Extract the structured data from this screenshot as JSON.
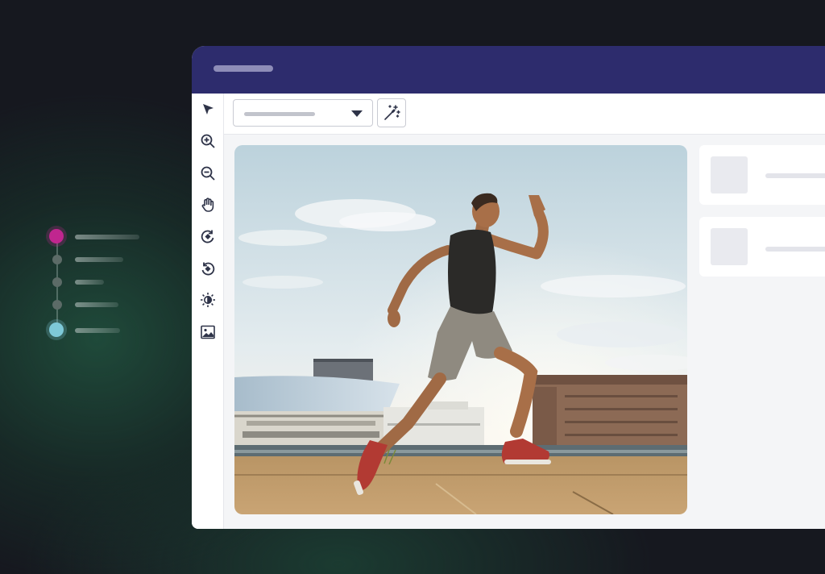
{
  "steps": [
    {
      "state": "active",
      "color": "#c0268f"
    },
    {
      "state": "pending"
    },
    {
      "state": "pending"
    },
    {
      "state": "pending"
    },
    {
      "state": "done",
      "color": "#7ec9d8"
    }
  ],
  "window": {
    "titlebar_color": "#2d2c6d",
    "tools": [
      "pointer-icon",
      "zoom-in-icon",
      "zoom-out-icon",
      "hand-icon",
      "rotate-right-icon",
      "rotate-left-icon",
      "brightness-icon",
      "image-icon"
    ],
    "toolbar": {
      "select_value": "",
      "magic_tool": "magic-wand-icon"
    },
    "image": {
      "subject": "photo-of-runner"
    },
    "results": [
      {
        "thumb": "result-thumbnail",
        "label": ""
      },
      {
        "thumb": "result-thumbnail",
        "label": ""
      }
    ],
    "accent": "#2e3348"
  }
}
